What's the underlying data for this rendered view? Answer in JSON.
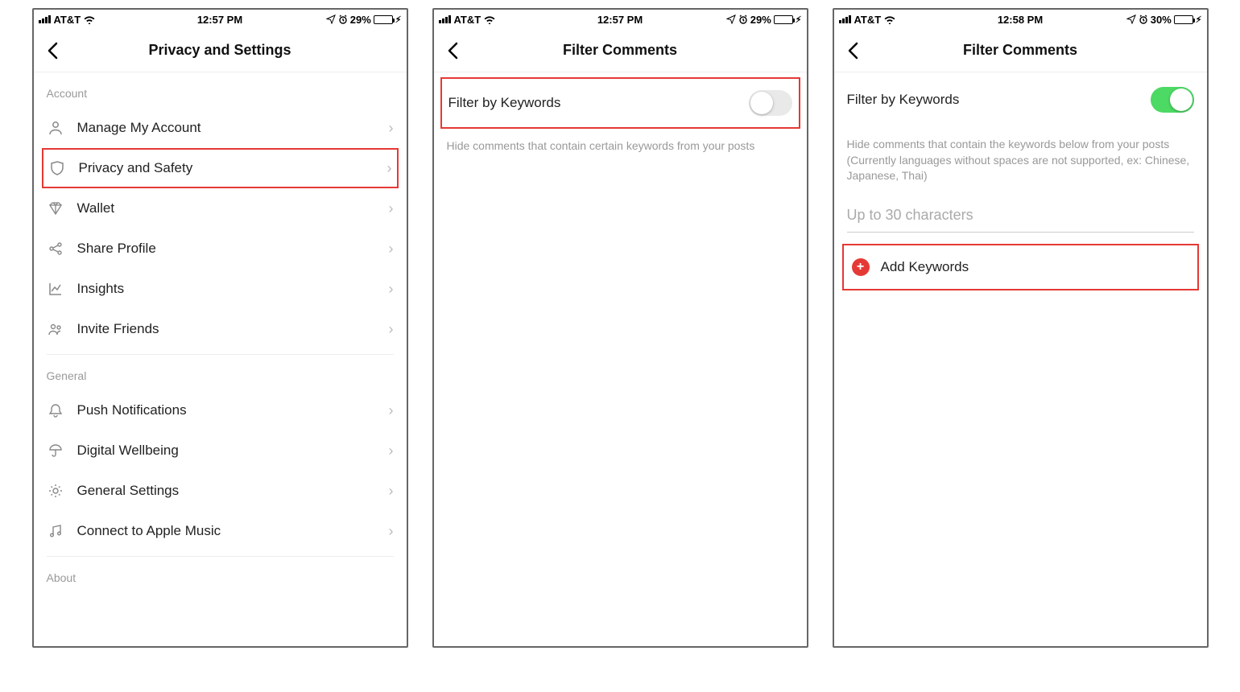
{
  "status": {
    "carrier": "AT&T",
    "battery_a": "29%",
    "battery_b": "30%",
    "time_a": "12:57 PM",
    "time_b": "12:58 PM"
  },
  "screen1": {
    "title": "Privacy and Settings",
    "section_account": "Account",
    "section_general": "General",
    "section_about": "About",
    "items": {
      "manage": "Manage My Account",
      "privacy": "Privacy and Safety",
      "wallet": "Wallet",
      "share": "Share Profile",
      "insights": "Insights",
      "invite": "Invite Friends",
      "push": "Push Notifications",
      "wellbeing": "Digital Wellbeing",
      "general_settings": "General Settings",
      "apple_music": "Connect to Apple Music"
    }
  },
  "screen2": {
    "title": "Filter Comments",
    "filter_label": "Filter by Keywords",
    "desc": "Hide comments that contain certain keywords from your posts"
  },
  "screen3": {
    "title": "Filter Comments",
    "filter_label": "Filter by Keywords",
    "desc": "Hide comments that contain the keywords below from your posts (Currently languages without spaces are not supported, ex: Chinese, Japanese, Thai)",
    "input_placeholder": "Up to 30 characters",
    "add_label": "Add Keywords"
  }
}
